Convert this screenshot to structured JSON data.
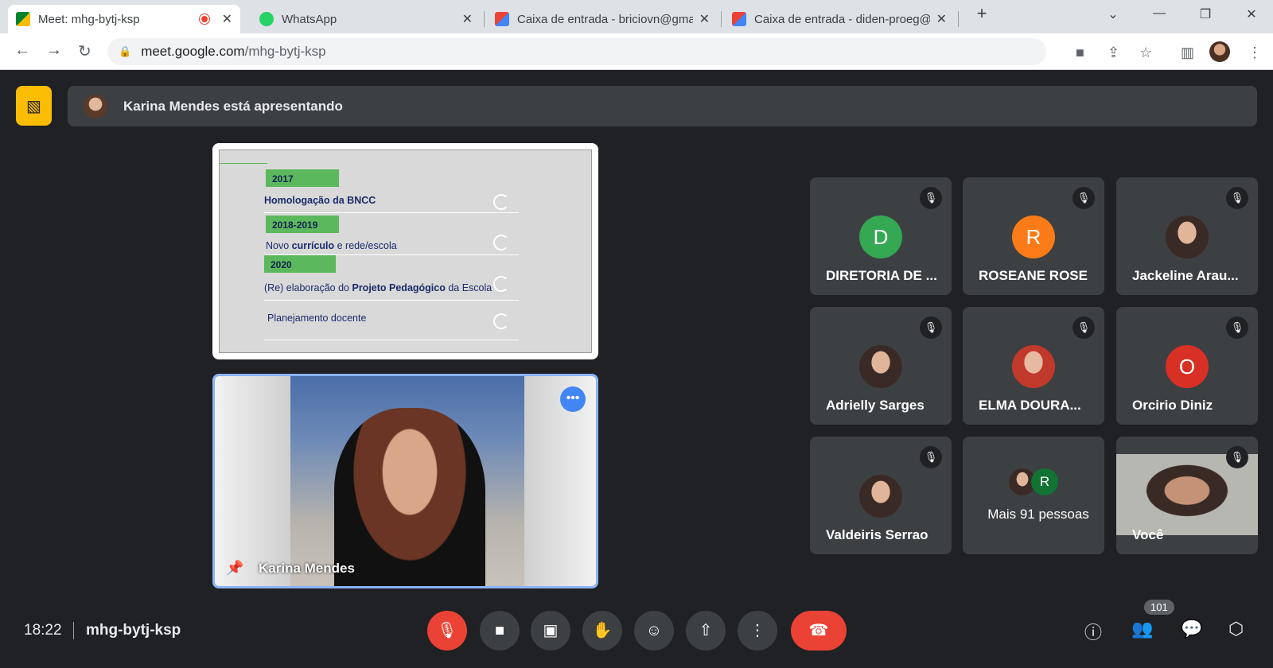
{
  "browser": {
    "tabs": [
      {
        "title": "Meet: mhg-bytj-ksp",
        "close": "✕"
      },
      {
        "title": "WhatsApp",
        "close": "✕"
      },
      {
        "title": "Caixa de entrada - briciovn@gma",
        "close": "✕"
      },
      {
        "title": "Caixa de entrada - diden-proeg@",
        "close": "✕"
      }
    ],
    "new_tab": "+",
    "url_host": "meet.google.com",
    "url_path": "/mhg-bytj-ksp"
  },
  "meet": {
    "presenting_banner": "Karina Mendes está apresentando",
    "slide": {
      "years": [
        "2017",
        "2018-2019",
        "2020"
      ],
      "item1": "Homologação da BNCC",
      "item2_a": "Novo ",
      "item2_b": "currículo",
      "item2_c": " e rede/escola",
      "item3_a": "(Re) elaboração do ",
      "item3_b": "Projeto Pedagógico",
      "item3_c": " da Escola",
      "item4": "Planejamento docente"
    },
    "presenter_name": "Karina Mendes",
    "participants": [
      {
        "name": "DIRETORIA DE ...",
        "initial": "D",
        "color": "#34a853"
      },
      {
        "name": "ROSEANE ROSE",
        "initial": "R",
        "color": "#fa7b17"
      },
      {
        "name": "Jackeline Arau...",
        "initial": "",
        "color": ""
      },
      {
        "name": "Adrielly Sarges",
        "initial": "",
        "color": ""
      },
      {
        "name": "ELMA DOURA...",
        "initial": "",
        "color": ""
      },
      {
        "name": "Orcirio Diniz",
        "initial": "O",
        "color": "#d93025"
      },
      {
        "name": "Valdeiris Serrao",
        "initial": "",
        "color": ""
      },
      {
        "name": "Mais 91 pessoas",
        "initial": "R",
        "color": "#137333"
      },
      {
        "name": "Você",
        "initial": "",
        "color": ""
      }
    ],
    "time": "18:22",
    "meeting_code": "mhg-bytj-ksp",
    "people_count": "101"
  }
}
